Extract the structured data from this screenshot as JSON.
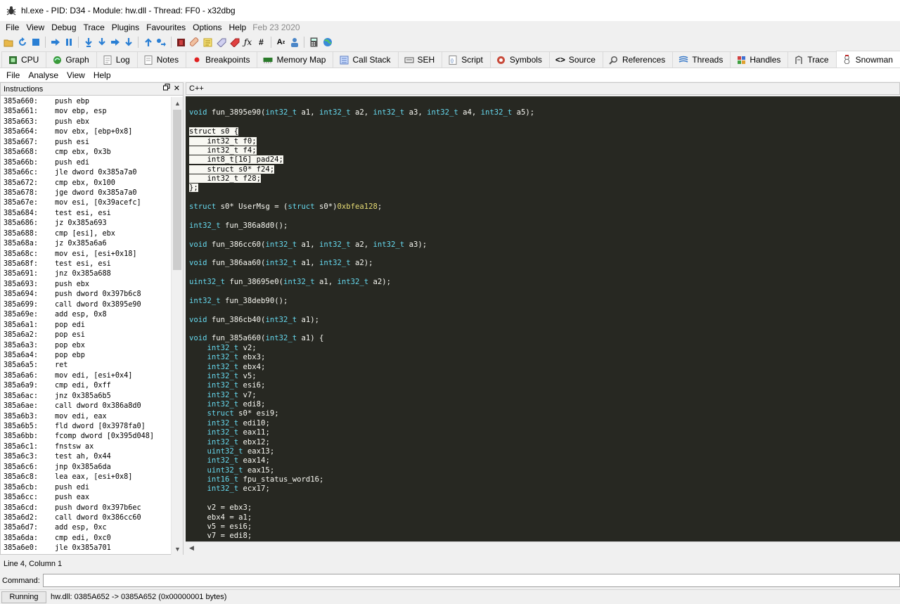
{
  "window": {
    "title": "hl.exe - PID: D34 - Module: hw.dll - Thread: FF0 - x32dbg",
    "icon": "bug-icon"
  },
  "menubar": {
    "items": [
      "File",
      "View",
      "Debug",
      "Trace",
      "Plugins",
      "Favourites",
      "Options",
      "Help"
    ],
    "date": "Feb 23 2020"
  },
  "tabs": [
    {
      "label": "CPU",
      "icon": "cpu-icon"
    },
    {
      "label": "Graph",
      "icon": "graph-icon"
    },
    {
      "label": "Log",
      "icon": "log-icon"
    },
    {
      "label": "Notes",
      "icon": "notes-icon"
    },
    {
      "label": "Breakpoints",
      "icon": "breakpoint-icon"
    },
    {
      "label": "Memory Map",
      "icon": "memory-icon"
    },
    {
      "label": "Call Stack",
      "icon": "callstack-icon"
    },
    {
      "label": "SEH",
      "icon": "seh-icon"
    },
    {
      "label": "Script",
      "icon": "script-icon"
    },
    {
      "label": "Symbols",
      "icon": "symbols-icon"
    },
    {
      "label": "Source",
      "icon": "source-icon"
    },
    {
      "label": "References",
      "icon": "references-icon"
    },
    {
      "label": "Threads",
      "icon": "threads-icon"
    },
    {
      "label": "Handles",
      "icon": "handles-icon"
    },
    {
      "label": "Trace",
      "icon": "trace-icon"
    },
    {
      "label": "Snowman",
      "icon": "snowman-icon"
    }
  ],
  "submenu": {
    "items": [
      "File",
      "Analyse",
      "View",
      "Help"
    ]
  },
  "instructions_pane": {
    "title": "Instructions",
    "rows": [
      [
        "385a660:",
        "push ebp"
      ],
      [
        "385a661:",
        "mov ebp, esp"
      ],
      [
        "385a663:",
        "push ebx"
      ],
      [
        "385a664:",
        "mov ebx, [ebp+0x8]"
      ],
      [
        "385a667:",
        "push esi"
      ],
      [
        "385a668:",
        "cmp ebx, 0x3b"
      ],
      [
        "385a66b:",
        "push edi"
      ],
      [
        "385a66c:",
        "jle dword 0x385a7a0"
      ],
      [
        "385a672:",
        "cmp ebx, 0x100"
      ],
      [
        "385a678:",
        "jge dword 0x385a7a0"
      ],
      [
        "385a67e:",
        "mov esi, [0x39acefc]"
      ],
      [
        "385a684:",
        "test esi, esi"
      ],
      [
        "385a686:",
        "jz 0x385a693"
      ],
      [
        "385a688:",
        "cmp [esi], ebx"
      ],
      [
        "385a68a:",
        "jz 0x385a6a6"
      ],
      [
        "385a68c:",
        "mov esi, [esi+0x18]"
      ],
      [
        "385a68f:",
        "test esi, esi"
      ],
      [
        "385a691:",
        "jnz 0x385a688"
      ],
      [
        "385a693:",
        "push ebx"
      ],
      [
        "385a694:",
        "push dword 0x397b6c8"
      ],
      [
        "385a699:",
        "call dword 0x3895e90"
      ],
      [
        "385a69e:",
        "add esp, 0x8"
      ],
      [
        "385a6a1:",
        "pop edi"
      ],
      [
        "385a6a2:",
        "pop esi"
      ],
      [
        "385a6a3:",
        "pop ebx"
      ],
      [
        "385a6a4:",
        "pop ebp"
      ],
      [
        "385a6a5:",
        "ret"
      ],
      [
        "385a6a6:",
        "mov edi, [esi+0x4]"
      ],
      [
        "385a6a9:",
        "cmp edi, 0xff"
      ],
      [
        "385a6ac:",
        "jnz 0x385a6b5"
      ],
      [
        "385a6ae:",
        "call dword 0x386a8d0"
      ],
      [
        "385a6b3:",
        "mov edi, eax"
      ],
      [
        "385a6b5:",
        "fld dword [0x3978fa0]"
      ],
      [
        "385a6bb:",
        "fcomp dword [0x395d048]"
      ],
      [
        "385a6c1:",
        "fnstsw ax"
      ],
      [
        "385a6c3:",
        "test ah, 0x44"
      ],
      [
        "385a6c6:",
        "jnp 0x385a6da"
      ],
      [
        "385a6c8:",
        "lea eax, [esi+0x8]"
      ],
      [
        "385a6cb:",
        "push edi"
      ],
      [
        "385a6cc:",
        "push eax"
      ],
      [
        "385a6cd:",
        "push dword 0x397b6ec"
      ],
      [
        "385a6d2:",
        "call dword 0x386cc60"
      ],
      [
        "385a6d7:",
        "add esp, 0xc"
      ],
      [
        "385a6da:",
        "cmp edi, 0xc0"
      ],
      [
        "385a6e0:",
        "jle 0x385a701"
      ]
    ]
  },
  "code_pane": {
    "title": "C++",
    "lines": [
      [],
      [
        [
          "void",
          "kw"
        ],
        [
          " fun_3895e90("
        ],
        [
          "int32_t",
          "kw"
        ],
        [
          " a1, "
        ],
        [
          "int32_t",
          "kw"
        ],
        [
          " a2, "
        ],
        [
          "int32_t",
          "kw"
        ],
        [
          " a3, "
        ],
        [
          "int32_t",
          "kw"
        ],
        [
          " a4, "
        ],
        [
          "int32_t",
          "kw"
        ],
        [
          " a5);"
        ]
      ],
      [],
      [
        [
          "struct s0 {",
          "sel"
        ]
      ],
      [
        [
          "    int32_t f0;",
          "sel"
        ]
      ],
      [
        [
          "    int32_t f4;",
          "sel"
        ]
      ],
      [
        [
          "    int8_t[16] pad24;",
          "sel"
        ]
      ],
      [
        [
          "    struct s0* f24;",
          "sel"
        ]
      ],
      [
        [
          "    int32_t f28;",
          "sel"
        ]
      ],
      [
        [
          "};",
          "sel"
        ]
      ],
      [],
      [
        [
          "struct",
          "kw"
        ],
        [
          " s0* UserMsg = ("
        ],
        [
          "struct",
          "kw"
        ],
        [
          " s0*)"
        ],
        [
          "0xbfea128",
          "lit"
        ],
        [
          ";"
        ]
      ],
      [],
      [
        [
          "int32_t",
          "kw"
        ],
        [
          " fun_386a8d0();"
        ]
      ],
      [],
      [
        [
          "void",
          "kw"
        ],
        [
          " fun_386cc60("
        ],
        [
          "int32_t",
          "kw"
        ],
        [
          " a1, "
        ],
        [
          "int32_t",
          "kw"
        ],
        [
          " a2, "
        ],
        [
          "int32_t",
          "kw"
        ],
        [
          " a3);"
        ]
      ],
      [],
      [
        [
          "void",
          "kw"
        ],
        [
          " fun_386aa60("
        ],
        [
          "int32_t",
          "kw"
        ],
        [
          " a1, "
        ],
        [
          "int32_t",
          "kw"
        ],
        [
          " a2);"
        ]
      ],
      [],
      [
        [
          "uint32_t",
          "kw"
        ],
        [
          " fun_38695e0("
        ],
        [
          "int32_t",
          "kw"
        ],
        [
          " a1, "
        ],
        [
          "int32_t",
          "kw"
        ],
        [
          " a2);"
        ]
      ],
      [],
      [
        [
          "int32_t",
          "kw"
        ],
        [
          " fun_38deb90();"
        ]
      ],
      [],
      [
        [
          "void",
          "kw"
        ],
        [
          " fun_386cb40("
        ],
        [
          "int32_t",
          "kw"
        ],
        [
          " a1);"
        ]
      ],
      [],
      [
        [
          "void",
          "kw"
        ],
        [
          " fun_385a660("
        ],
        [
          "int32_t",
          "kw"
        ],
        [
          " a1) {"
        ]
      ],
      [
        [
          "    "
        ],
        [
          "int32_t",
          "kw"
        ],
        [
          " v2;"
        ]
      ],
      [
        [
          "    "
        ],
        [
          "int32_t",
          "kw"
        ],
        [
          " ebx3;"
        ]
      ],
      [
        [
          "    "
        ],
        [
          "int32_t",
          "kw"
        ],
        [
          " ebx4;"
        ]
      ],
      [
        [
          "    "
        ],
        [
          "int32_t",
          "kw"
        ],
        [
          " v5;"
        ]
      ],
      [
        [
          "    "
        ],
        [
          "int32_t",
          "kw"
        ],
        [
          " esi6;"
        ]
      ],
      [
        [
          "    "
        ],
        [
          "int32_t",
          "kw"
        ],
        [
          " v7;"
        ]
      ],
      [
        [
          "    "
        ],
        [
          "int32_t",
          "kw"
        ],
        [
          " edi8;"
        ]
      ],
      [
        [
          "    "
        ],
        [
          "struct",
          "kw"
        ],
        [
          " s0* esi9;"
        ]
      ],
      [
        [
          "    "
        ],
        [
          "int32_t",
          "kw"
        ],
        [
          " edi10;"
        ]
      ],
      [
        [
          "    "
        ],
        [
          "int32_t",
          "kw"
        ],
        [
          " eax11;"
        ]
      ],
      [
        [
          "    "
        ],
        [
          "int32_t",
          "kw"
        ],
        [
          " ebx12;"
        ]
      ],
      [
        [
          "    "
        ],
        [
          "uint32_t",
          "kw"
        ],
        [
          " eax13;"
        ]
      ],
      [
        [
          "    "
        ],
        [
          "int32_t",
          "kw"
        ],
        [
          " eax14;"
        ]
      ],
      [
        [
          "    "
        ],
        [
          "uint32_t",
          "kw"
        ],
        [
          " eax15;"
        ]
      ],
      [
        [
          "    "
        ],
        [
          "int16_t",
          "kw"
        ],
        [
          " fpu_status_word16;"
        ]
      ],
      [
        [
          "    "
        ],
        [
          "int32_t",
          "kw"
        ],
        [
          " ecx17;"
        ]
      ],
      [],
      [
        [
          "    v2 = ebx3;"
        ]
      ],
      [
        [
          "    ebx4 = a1;"
        ]
      ],
      [
        [
          "    v5 = esi6;"
        ]
      ],
      [
        [
          "    v7 = edi8;"
        ]
      ]
    ]
  },
  "status": {
    "cursor": "Line 4, Column 1",
    "command_label": "Command:",
    "command_value": "",
    "state": "Running",
    "message": "hw.dll: 0385A652 -> 0385A652 (0x00000001 bytes)"
  },
  "colors": {
    "editor_bg": "#272822",
    "editor_fg": "#f8f8f2",
    "keyword": "#66d9ef",
    "literal": "#e6db74"
  }
}
